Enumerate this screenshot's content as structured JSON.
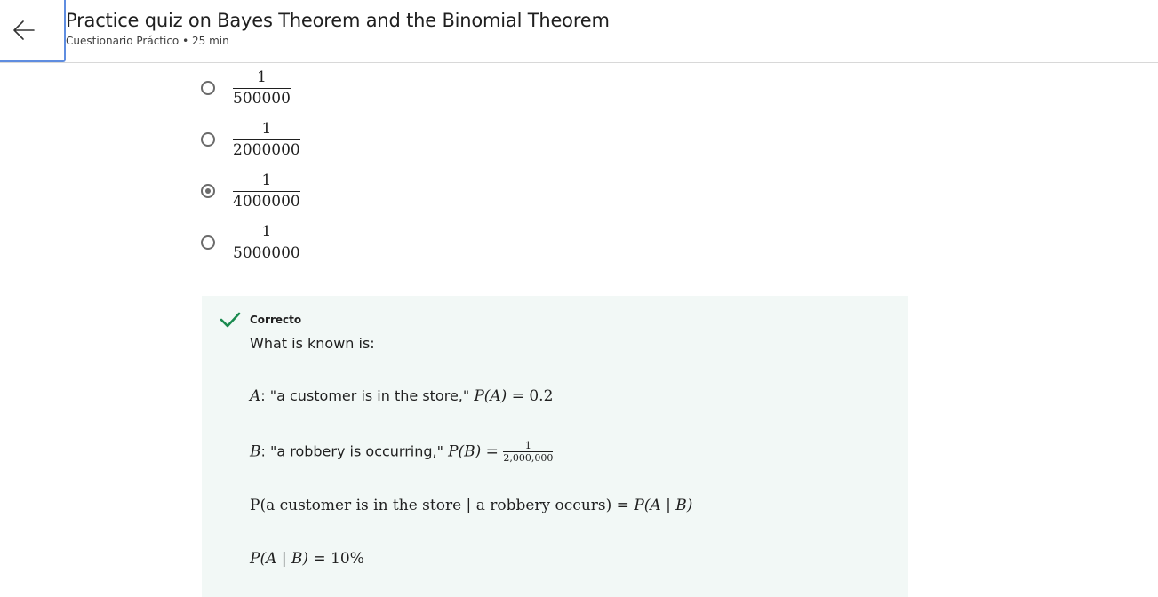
{
  "header": {
    "title": "Practice quiz on Bayes Theorem and the Binomial Theorem",
    "subtitle": "Cuestionario Práctico • 25 min"
  },
  "options": [
    {
      "numerator": "1",
      "denominator": "500000",
      "selected": false
    },
    {
      "numerator": "1",
      "denominator": "2000000",
      "selected": false
    },
    {
      "numerator": "1",
      "denominator": "4000000",
      "selected": true
    },
    {
      "numerator": "1",
      "denominator": "5000000",
      "selected": false
    }
  ],
  "feedback": {
    "status": "Correcto",
    "intro": "What is known is:",
    "line_a": {
      "var": "A",
      "text": ": \"a customer is in the store,\" ",
      "prob": "P(A)",
      "eq": " = 0.2"
    },
    "line_b": {
      "var": "B",
      "text": ": \"a robbery is occurring,\" ",
      "prob": "P(B)",
      "eq": " = ",
      "frac_num": "1",
      "frac_den": "2,000,000"
    },
    "line_c": {
      "lhs": "P(a customer is in the store | a robbery occurs)",
      "rhs": " = P(A | B)"
    },
    "line_d": {
      "lhs": "P(A | B)",
      "rhs": " = 10%"
    }
  },
  "colors": {
    "accent_focus": "#5f8de0",
    "feedback_bg": "#f2f8f6",
    "check": "#1a8a4f"
  }
}
